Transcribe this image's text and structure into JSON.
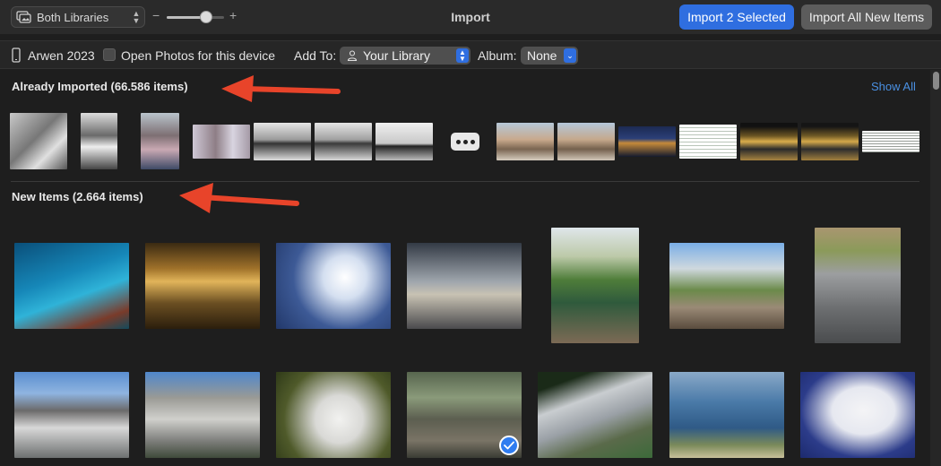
{
  "toolbar": {
    "library_select": "Both Libraries",
    "zoom_minus": "−",
    "zoom_plus": "+",
    "zoom_level": 0.68,
    "title": "Import",
    "import_selected_label": "Import 2 Selected",
    "import_all_label": "Import All New Items"
  },
  "options": {
    "device_name": "Arwen 2023",
    "open_photos_label": "Open Photos for this device",
    "open_photos_checked": false,
    "add_to_label": "Add To:",
    "add_to_value": "Your Library",
    "album_label": "Album:",
    "album_value": "None"
  },
  "already_imported": {
    "title": "Already Imported (66.586 items)",
    "show_all": "Show All"
  },
  "new_items": {
    "title": "New Items (2.664 items)"
  },
  "colors": {
    "accent": "#2f6ee0",
    "link": "#4a90e2",
    "annotation_arrow": "#e8442a",
    "background": "#1e1e1e"
  }
}
